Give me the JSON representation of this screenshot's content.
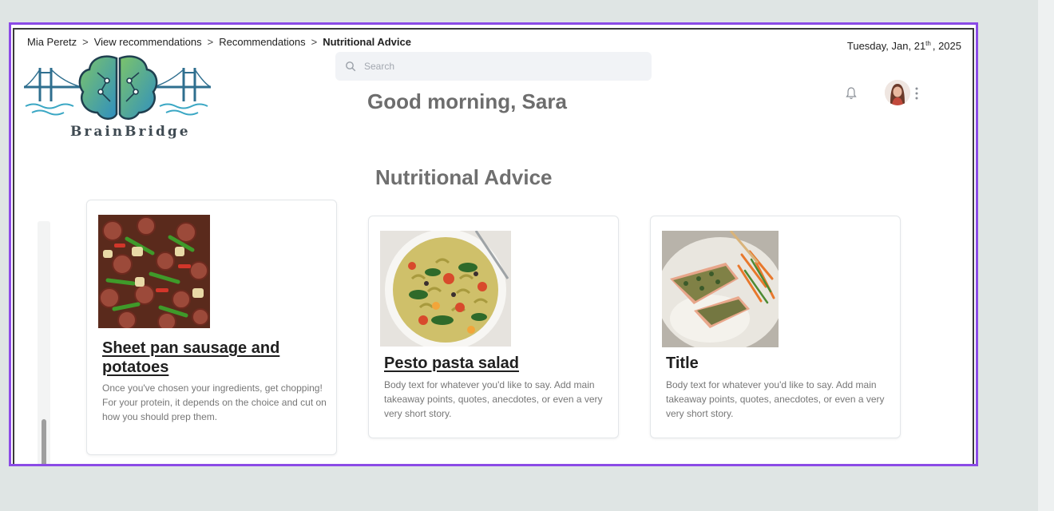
{
  "breadcrumb": {
    "items": [
      "Mia Peretz",
      "View recommendations",
      "Recommendations",
      "Nutritional Advice"
    ],
    "separator": ">"
  },
  "date": {
    "prefix": "Tuesday,  Jan, 21",
    "suffix": "th",
    "year": ", 2025"
  },
  "search": {
    "placeholder": "Search"
  },
  "greeting": "Good morning, Sara",
  "logo": {
    "text": "BrainBridge"
  },
  "section_title": "Nutritional Advice",
  "cards": [
    {
      "title": "Sheet pan sausage and potatoes",
      "body": "Once you've chosen your ingredients, get chopping! For your protein, it depends on the choice and cut on how you should prep them.",
      "image": "sausage-potatoes-photo"
    },
    {
      "title": "Pesto pasta salad",
      "body": "Body text for whatever you'd like to say. Add main takeaway points, quotes, anecdotes, or even a very very short story.",
      "image": "pasta-salad-photo"
    },
    {
      "title": "Title",
      "body": "Body text for whatever you'd like to say. Add main takeaway points, quotes, anecdotes, or even a very very short story.",
      "image": "salmon-rice-photo"
    }
  ],
  "icons": [
    "search-icon",
    "bell-icon",
    "avatar",
    "kebab-menu-icon",
    "brainbridge-logo"
  ],
  "colors": {
    "frame": "#8b4be6",
    "heading": "#6f6f6f",
    "logo_teal": "#3aa7c4",
    "logo_green": "#7cc46a"
  }
}
